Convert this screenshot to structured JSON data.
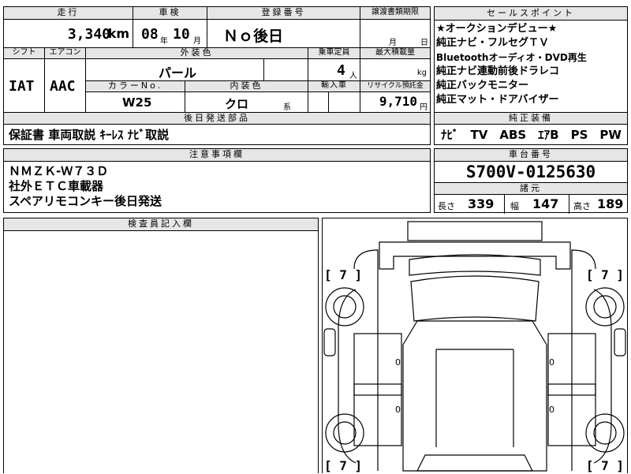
{
  "spec": {
    "headers": {
      "mileage": "走行",
      "inspection": "車検",
      "registration": "登録番号",
      "transfer_deadline": "譲渡書類期限",
      "shift": "シフト",
      "aircon": "エアコン",
      "exterior_color": "外装色",
      "capacity": "乗車定員",
      "max_load": "最大積載量",
      "color_no": "カラーNo.",
      "interior_color": "内装色",
      "import": "輸入車",
      "recycle": "リサイクル預託金"
    },
    "mileage_value": "3,340",
    "mileage_unit": "km",
    "inspection_year": "08",
    "inspection_year_unit": "年",
    "inspection_month": "10",
    "inspection_month_unit": "月",
    "registration_value": "Ｎｏ後日",
    "transfer_month_unit": "月",
    "transfer_day_unit": "日",
    "shift_value": "IAT",
    "aircon_value": "AAC",
    "exterior_color_value": "パール",
    "capacity_value": "4",
    "capacity_unit": "人",
    "max_load_unit": "kg",
    "color_no_value": "W25",
    "interior_color_value": "クロ",
    "interior_color_suffix": "系",
    "recycle_value": "9,710",
    "recycle_unit": "円"
  },
  "sales_points": {
    "header": "セールスポイント",
    "items": [
      "★オークションデビュー★",
      "純正ナビ・フルセグＴＶ",
      "Bluetoothオーディオ・DVD再生",
      "純正ナビ連動前後ドラレコ",
      "純正バックモニター",
      "純正マット・ドアバイザー"
    ]
  },
  "later_parts": {
    "header": "後日発送部品",
    "value": "保証書 車両取説 ｷｰﾚｽ ﾅﾋﾞ取説"
  },
  "genuine_equipment": {
    "header": "純正装備",
    "value": "ﾅﾋﾞ　TV　ABS　ｴｱB　PS　PW"
  },
  "notes": {
    "header": "注意事項欄",
    "lines": [
      "ＮＭＺＫ-Ｗ７３Ｄ",
      "社外ＥＴＣ車載器",
      "スペアリモコンキー後日発送"
    ]
  },
  "chassis": {
    "header": "車台番号",
    "value": "S700V-0125630"
  },
  "dimensions": {
    "header": "諸元",
    "length_label": "長さ",
    "length_value": "339",
    "width_label": "幅",
    "width_value": "147",
    "height_label": "高さ",
    "height_value": "189"
  },
  "inspector": {
    "header": "検査員記入欄"
  },
  "diagram": {
    "tire_marks": [
      "[ 7 ]",
      "[ 7 ]",
      "[ 7 ]",
      "[ 7 ]"
    ],
    "zero_marks": [
      "0",
      "0",
      "0",
      "0"
    ]
  }
}
